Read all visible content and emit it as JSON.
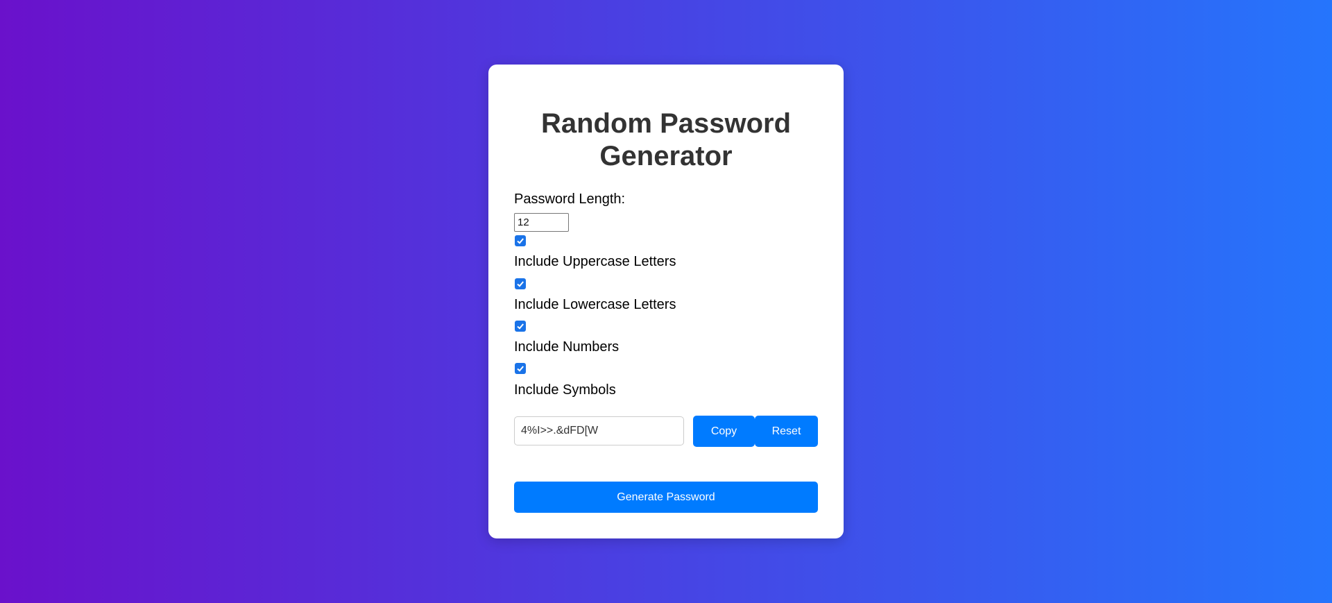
{
  "app": {
    "title": "Random Password Generator"
  },
  "length": {
    "label": "Password Length:",
    "value": "12"
  },
  "options": [
    {
      "label": "Include Uppercase Letters",
      "checked": true
    },
    {
      "label": "Include Lowercase Letters",
      "checked": true
    },
    {
      "label": "Include Numbers",
      "checked": true
    },
    {
      "label": "Include Symbols",
      "checked": true
    }
  ],
  "output": {
    "value": "4%I>>.&dFD[W"
  },
  "buttons": {
    "copy": "Copy",
    "reset": "Reset",
    "generate": "Generate Password"
  },
  "colors": {
    "gradient_start": "#6a11cb",
    "gradient_end": "#2575fc",
    "accent": "#007bff",
    "title": "#333333"
  }
}
